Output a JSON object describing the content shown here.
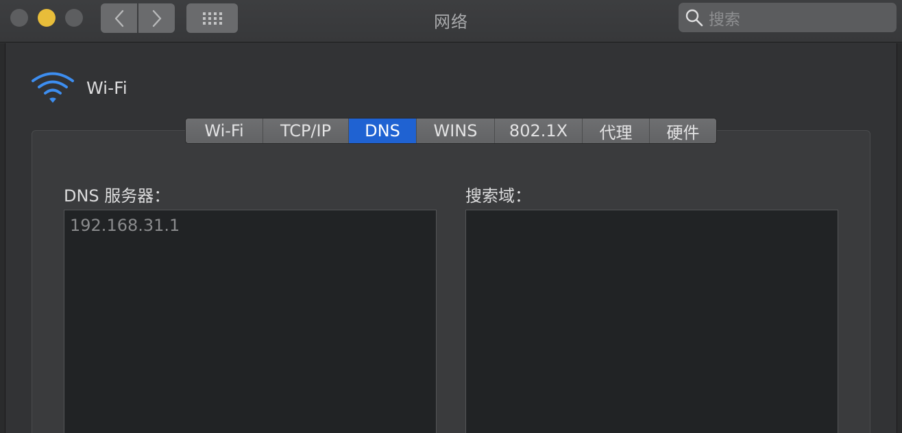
{
  "window": {
    "title": "网络",
    "search_placeholder": "搜索"
  },
  "interface": {
    "name": "Wi-Fi"
  },
  "tabs": [
    {
      "label": "Wi-Fi",
      "active": false
    },
    {
      "label": "TCP/IP",
      "active": false
    },
    {
      "label": "DNS",
      "active": true
    },
    {
      "label": "WINS",
      "active": false
    },
    {
      "label": "802.1X",
      "active": false
    },
    {
      "label": "代理",
      "active": false
    },
    {
      "label": "硬件",
      "active": false
    }
  ],
  "dns_servers": {
    "label": "DNS 服务器：",
    "entries": [
      "192.168.31.1"
    ]
  },
  "search_domains": {
    "label": "搜索域：",
    "entries": []
  },
  "colors": {
    "accent": "#1f62d2",
    "wifi_icon": "#3d8ef0",
    "minimize": "#e8bd3a"
  }
}
